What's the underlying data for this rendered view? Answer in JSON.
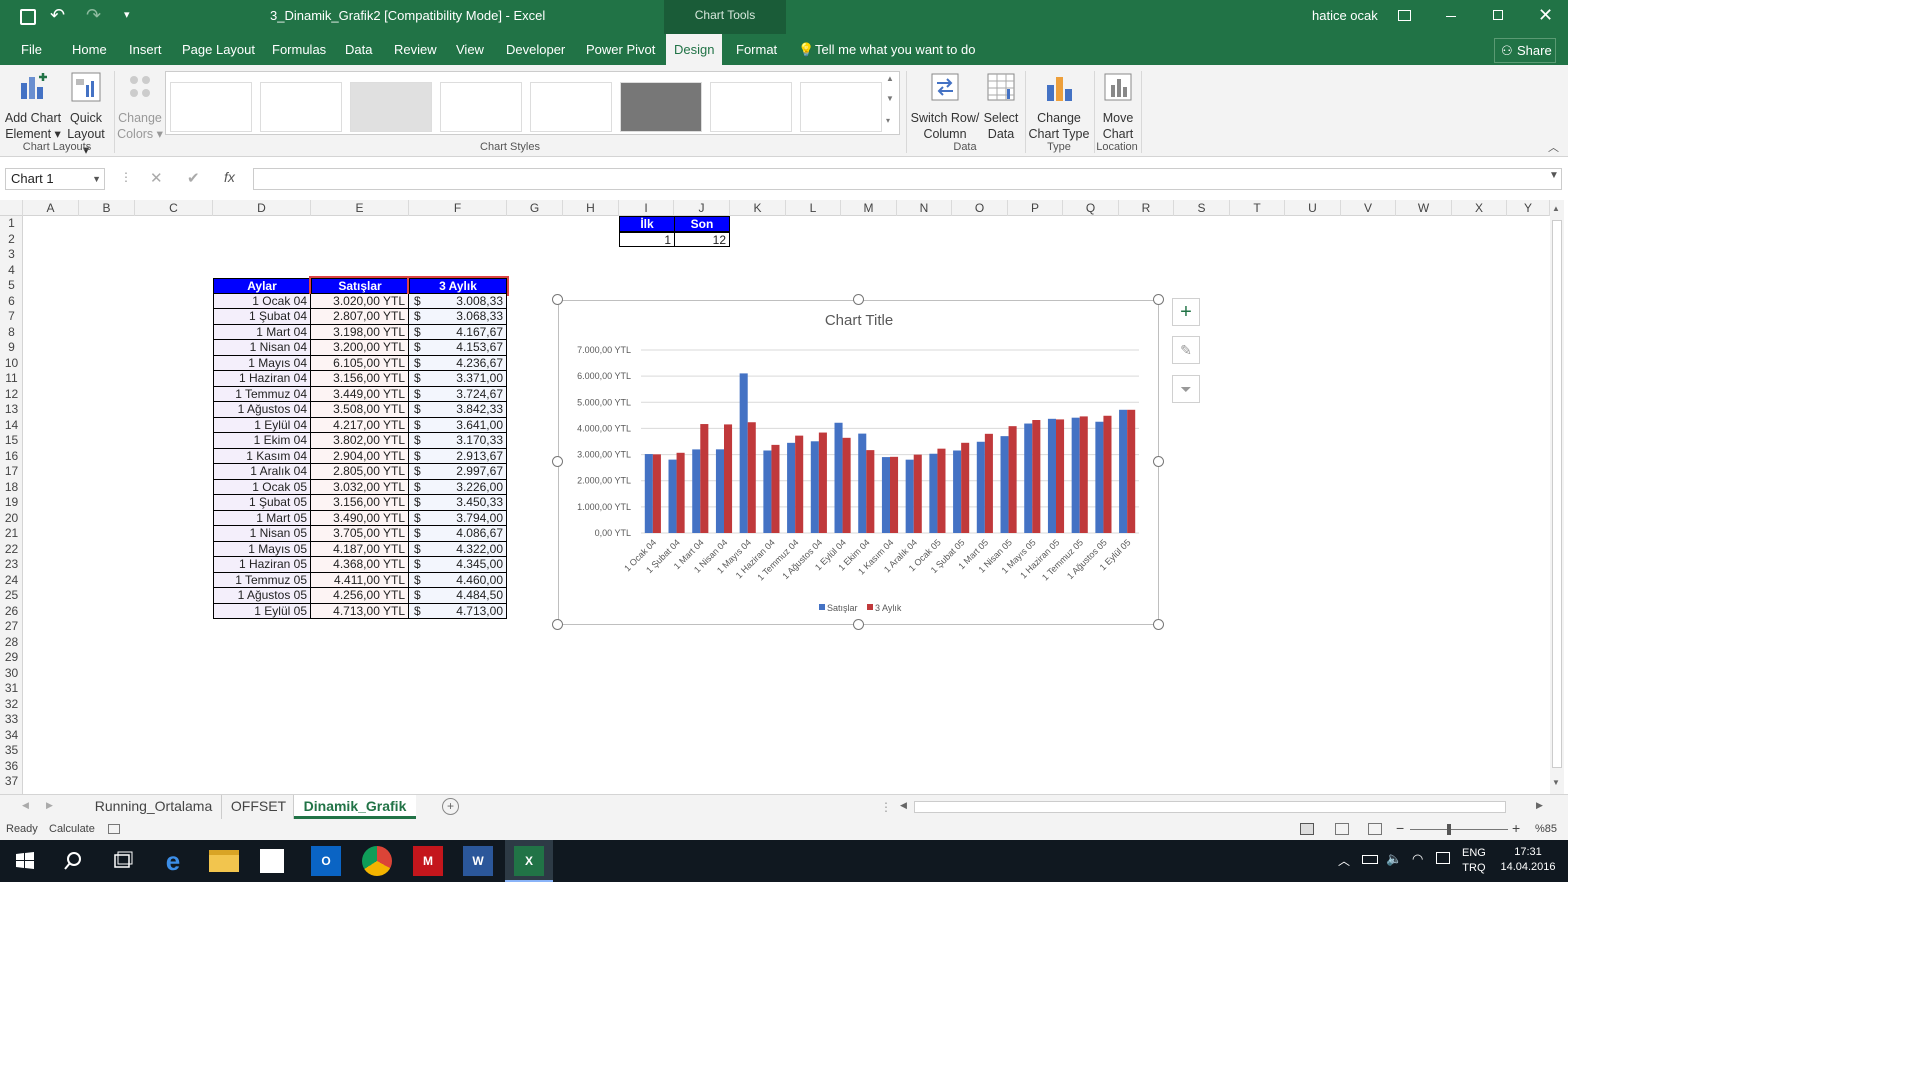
{
  "titlebar": {
    "doc_title": "3_Dinamik_Grafik2  [Compatibility Mode]  -  Excel",
    "context_title": "Chart Tools",
    "user": "hatice ocak"
  },
  "tabs": [
    "File",
    "Home",
    "Insert",
    "Page Layout",
    "Formulas",
    "Data",
    "Review",
    "View",
    "Developer",
    "Power Pivot",
    "Design",
    "Format"
  ],
  "tell_me": "Tell me what you want to do",
  "share": "Share",
  "ribbon": {
    "add_chart_element": [
      "Add Chart",
      "Element ▾"
    ],
    "quick_layout": [
      "Quick",
      "Layout ▾"
    ],
    "change_colors": [
      "Change",
      "Colors ▾"
    ],
    "switch_row_col": [
      "Switch Row/",
      "Column"
    ],
    "select_data": [
      "Select",
      "Data"
    ],
    "change_chart_type": [
      "Change",
      "Chart Type"
    ],
    "move_chart": [
      "Move",
      "Chart"
    ],
    "groups": {
      "chart_layouts": "Chart Layouts",
      "chart_styles": "Chart Styles",
      "data": "Data",
      "type": "Type",
      "location": "Location"
    }
  },
  "formula_bar": {
    "name_box": "Chart 1",
    "fx": "fx",
    "value": ""
  },
  "columns": [
    "A",
    "B",
    "C",
    "D",
    "E",
    "F",
    "G",
    "H",
    "I",
    "J",
    "K",
    "L",
    "M",
    "N",
    "O",
    "P",
    "Q",
    "R",
    "S",
    "T",
    "U",
    "V",
    "W",
    "X",
    "Y"
  ],
  "rows": [
    "1",
    "2",
    "3",
    "4",
    "5",
    "6",
    "7",
    "8",
    "9",
    "10",
    "11",
    "12",
    "13",
    "14",
    "15",
    "16",
    "17",
    "18",
    "19",
    "20",
    "21",
    "22",
    "23",
    "24",
    "25",
    "26",
    "27",
    "28",
    "29",
    "30",
    "31",
    "32",
    "33",
    "34",
    "35",
    "36",
    "37"
  ],
  "ilk_son": {
    "headers": [
      "İlk",
      "Son"
    ],
    "values": [
      "1",
      "12"
    ]
  },
  "table": {
    "headers": [
      "Aylar",
      "Satışlar",
      "3 Aylık"
    ],
    "rows": [
      [
        "1 Ocak 04",
        "3.020,00 YTL",
        "$",
        "3.008,33"
      ],
      [
        "1 Şubat 04",
        "2.807,00 YTL",
        "$",
        "3.068,33"
      ],
      [
        "1 Mart 04",
        "3.198,00 YTL",
        "$",
        "4.167,67"
      ],
      [
        "1 Nisan 04",
        "3.200,00 YTL",
        "$",
        "4.153,67"
      ],
      [
        "1 Mayıs 04",
        "6.105,00 YTL",
        "$",
        "4.236,67"
      ],
      [
        "1 Haziran 04",
        "3.156,00 YTL",
        "$",
        "3.371,00"
      ],
      [
        "1 Temmuz 04",
        "3.449,00 YTL",
        "$",
        "3.724,67"
      ],
      [
        "1 Ağustos 04",
        "3.508,00 YTL",
        "$",
        "3.842,33"
      ],
      [
        "1 Eylül 04",
        "4.217,00 YTL",
        "$",
        "3.641,00"
      ],
      [
        "1 Ekim 04",
        "3.802,00 YTL",
        "$",
        "3.170,33"
      ],
      [
        "1 Kasım 04",
        "2.904,00 YTL",
        "$",
        "2.913,67"
      ],
      [
        "1 Aralık 04",
        "2.805,00 YTL",
        "$",
        "2.997,67"
      ],
      [
        "1 Ocak 05",
        "3.032,00 YTL",
        "$",
        "3.226,00"
      ],
      [
        "1 Şubat 05",
        "3.156,00 YTL",
        "$",
        "3.450,33"
      ],
      [
        "1 Mart 05",
        "3.490,00 YTL",
        "$",
        "3.794,00"
      ],
      [
        "1 Nisan 05",
        "3.705,00 YTL",
        "$",
        "4.086,67"
      ],
      [
        "1 Mayıs 05",
        "4.187,00 YTL",
        "$",
        "4.322,00"
      ],
      [
        "1 Haziran 05",
        "4.368,00 YTL",
        "$",
        "4.345,00"
      ],
      [
        "1 Temmuz 05",
        "4.411,00 YTL",
        "$",
        "4.460,00"
      ],
      [
        "1 Ağustos 05",
        "4.256,00 YTL",
        "$",
        "4.484,50"
      ],
      [
        "1 Eylül 05",
        "4.713,00 YTL",
        "$",
        "4.713,00"
      ]
    ]
  },
  "chart_data": {
    "type": "bar",
    "title": "Chart Title",
    "categories": [
      "1 Ocak 04",
      "1 Şubat 04",
      "1 Mart 04",
      "1 Nisan 04",
      "1 Mayıs 04",
      "1 Haziran 04",
      "1 Temmuz 04",
      "1 Ağustos 04",
      "1 Eylül 04",
      "1 Ekim 04",
      "1 Kasım 04",
      "1 Aralık 04",
      "1 Ocak 05",
      "1 Şubat 05",
      "1 Mart 05",
      "1 Nisan 05",
      "1 Mayıs 05",
      "1 Haziran 05",
      "1 Temmuz 05",
      "1 Ağustos 05",
      "1 Eylül 05"
    ],
    "series": [
      {
        "name": "Satışlar",
        "color": "#4472c4",
        "values": [
          3020,
          2807,
          3198,
          3200,
          6105,
          3156,
          3449,
          3508,
          4217,
          3802,
          2904,
          2805,
          3032,
          3156,
          3490,
          3705,
          4187,
          4368,
          4411,
          4256,
          4713
        ]
      },
      {
        "name": "3 Aylık",
        "color": "#c0393b",
        "values": [
          3008.33,
          3068.33,
          4167.67,
          4153.67,
          4236.67,
          3371,
          3724.67,
          3842.33,
          3641,
          3170.33,
          2913.67,
          2997.67,
          3226,
          3450.33,
          3794,
          4086.67,
          4322,
          4345,
          4460,
          4484.5,
          4713
        ]
      }
    ],
    "ylim": [
      0,
      7000
    ],
    "yticks": [
      "0,00 YTL",
      "1.000,00 YTL",
      "2.000,00 YTL",
      "3.000,00 YTL",
      "4.000,00 YTL",
      "5.000,00 YTL",
      "6.000,00 YTL",
      "7.000,00 YTL"
    ],
    "legend": "bottom",
    "grid": true
  },
  "sheets": [
    "Running_Ortalama",
    "OFFSET",
    "Dinamik_Grafik"
  ],
  "active_sheet": "Dinamik_Grafik",
  "status": {
    "ready": "Ready",
    "calculate": "Calculate",
    "zoom": "%85"
  },
  "taskbar": {
    "lang": "ENG",
    "lang2": "TRQ",
    "time": "17:31",
    "date": "14.04.2016"
  }
}
